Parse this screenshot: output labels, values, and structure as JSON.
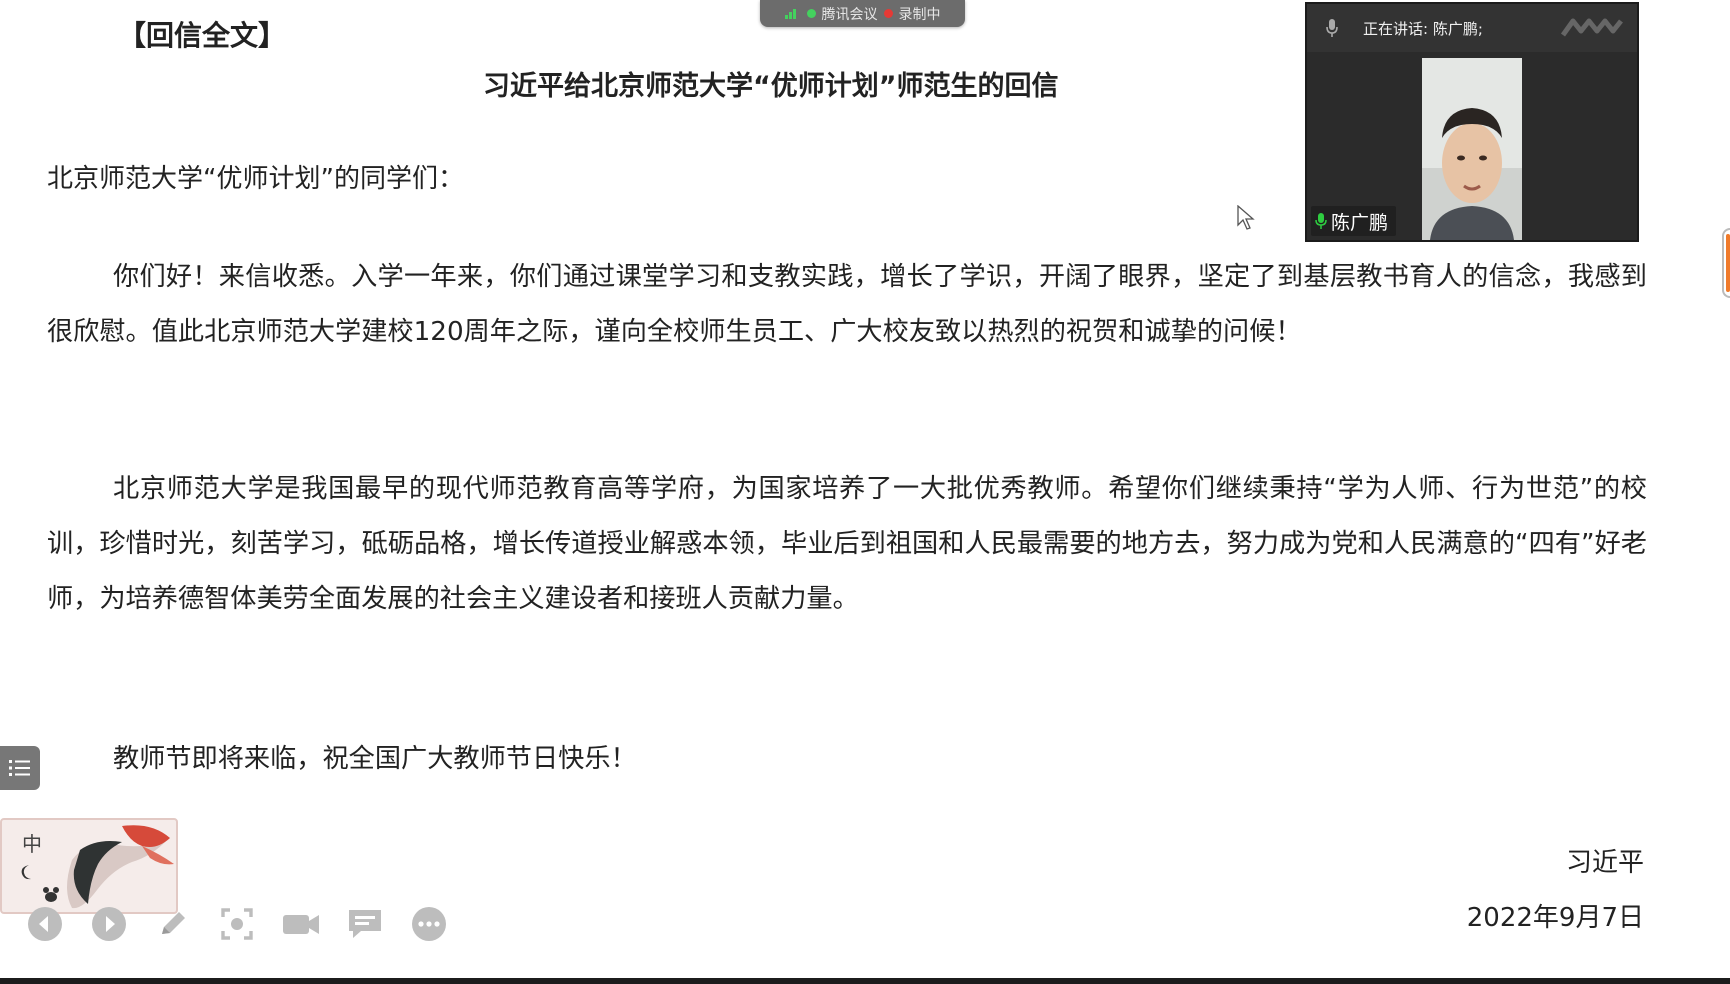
{
  "document": {
    "section_heading": "【回信全文】",
    "title": "习近平给北京师范大学“优师计划”师范生的回信",
    "salutation": "北京师范大学“优师计划”的同学们：",
    "paragraphs": [
      "你们好！来信收悉。入学一年来，你们通过课堂学习和支教实践，增长了学识，开阔了眼界，坚定了到基层教书育人的信念，我感到很欣慰。值此北京师范大学建校120周年之际，谨向全校师生员工、广大校友致以热烈的祝贺和诚挚的问候！",
      "北京师范大学是我国最早的现代师范教育高等学府，为国家培养了一大批优秀教师。希望你们继续秉持“学为人师、行为世范”的校训，珍惜时光，刻苦学习，砥砺品格，增长传道授业解惑本领，毕业后到祖国和人民最需要的地方去，努力成为党和人民满意的“四有”好老师，为培养德智体美劳全面发展的社会主义建设者和接班人贡献力量。",
      "教师节即将来临，祝全国广大教师节日快乐！"
    ],
    "signature": "习近平",
    "date": "2022年9月7日"
  },
  "meeting_badge": {
    "app_name": "腾讯会议",
    "recording_label": "录制中",
    "signal_color": "#44d15e",
    "recording_color": "#e53935"
  },
  "video_panel": {
    "speaking_label": "正在讲话: 陈广鹏;",
    "participant_name": "陈广鹏"
  },
  "ime": {
    "mode": "中"
  },
  "toolbar": {
    "items": [
      "prev-icon",
      "next-icon",
      "pen-icon",
      "screenshot-icon",
      "camera-icon",
      "comment-icon",
      "more-icon"
    ]
  },
  "colors": {
    "accent": "#f07a2a",
    "mic_green": "#2ecc40"
  }
}
